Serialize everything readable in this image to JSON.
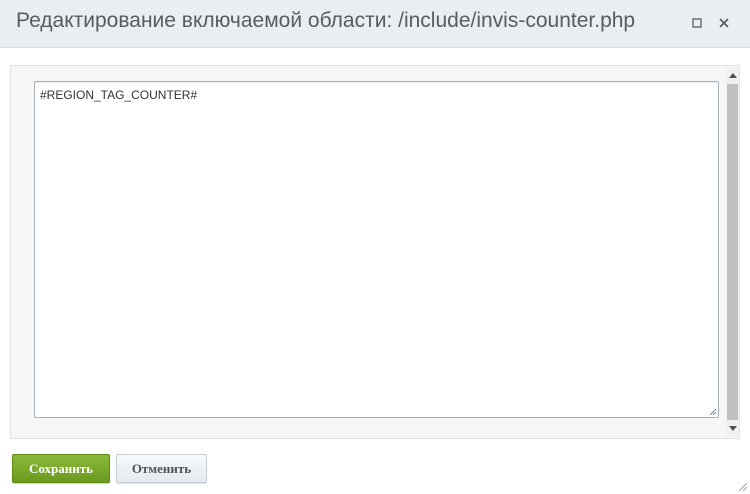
{
  "dialog": {
    "title": "Редактирование включаемой области: /include/invis-counter.php",
    "controls": {
      "maximize_icon": "maximize-icon",
      "close_icon": "close-icon"
    }
  },
  "editor": {
    "content": "#REGION_TAG_COUNTER#"
  },
  "buttons": {
    "save_label": "Сохранить",
    "cancel_label": "Отменить"
  },
  "colors": {
    "titlebar_bg": "#e9eef2",
    "save_button": "#7aab2b",
    "cancel_button": "#eef1f3"
  }
}
